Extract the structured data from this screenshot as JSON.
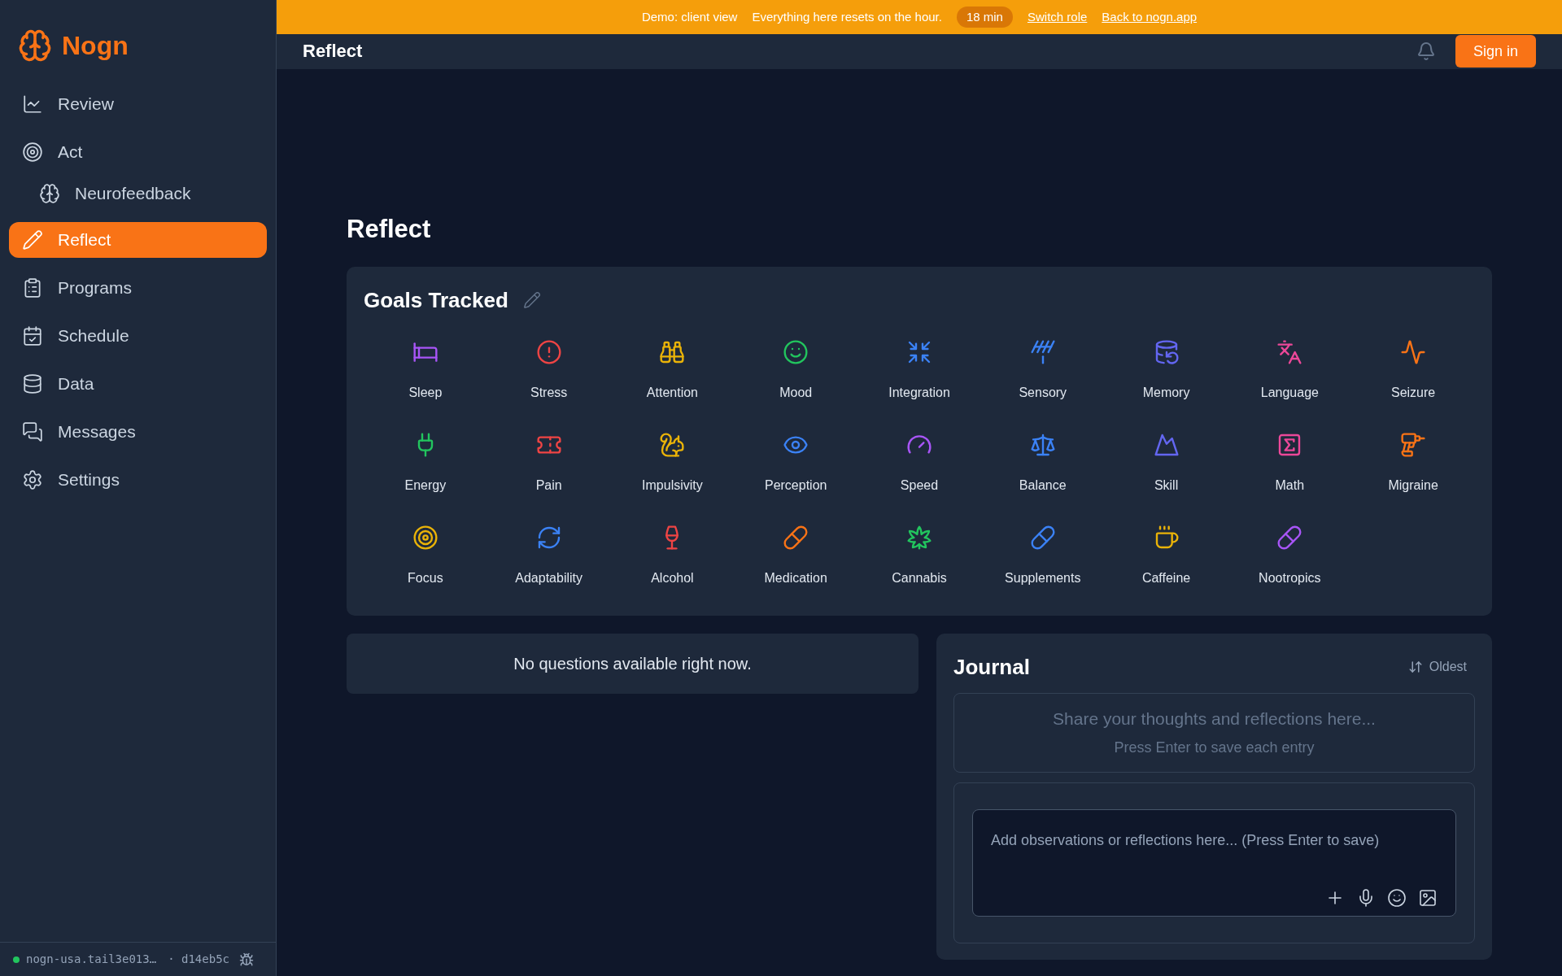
{
  "banner": {
    "mode": "Demo: client view",
    "note": "Everything here resets on the hour.",
    "timer": "18 min",
    "links": [
      "Switch role",
      "Back to nogn.app"
    ]
  },
  "header": {
    "title": "Reflect",
    "sign_in": "Sign in"
  },
  "sidebar": {
    "logo": "Nogn",
    "items": [
      {
        "label": "Review",
        "selected": false
      },
      {
        "label": "Act",
        "selected": false,
        "children": [
          {
            "label": "Neurofeedback",
            "selected": false
          }
        ]
      },
      {
        "label": "Reflect",
        "selected": true
      },
      {
        "label": "Programs",
        "selected": false
      },
      {
        "label": "Schedule",
        "selected": false
      },
      {
        "label": "Data",
        "selected": false
      },
      {
        "label": "Messages",
        "selected": false
      },
      {
        "label": "Settings",
        "selected": false
      }
    ],
    "status": {
      "host": "nogn-usa.tail3e013…",
      "commit": "· d14eb5c",
      "online": true
    }
  },
  "page_title": "Reflect",
  "goals": {
    "title": "Goals Tracked",
    "items": [
      {
        "label": "Sleep",
        "color": "#a855f7"
      },
      {
        "label": "Stress",
        "color": "#ef4444"
      },
      {
        "label": "Attention",
        "color": "#eab308"
      },
      {
        "label": "Mood",
        "color": "#22c55e"
      },
      {
        "label": "Integration",
        "color": "#3b82f6"
      },
      {
        "label": "Sensory",
        "color": "#3b82f6"
      },
      {
        "label": "Memory",
        "color": "#6366f1"
      },
      {
        "label": "Language",
        "color": "#ec4899"
      },
      {
        "label": "Seizure",
        "color": "#f97316"
      },
      {
        "label": "Energy",
        "color": "#22c55e"
      },
      {
        "label": "Pain",
        "color": "#ef4444"
      },
      {
        "label": "Impulsivity",
        "color": "#eab308"
      },
      {
        "label": "Perception",
        "color": "#3b82f6"
      },
      {
        "label": "Speed",
        "color": "#a855f7"
      },
      {
        "label": "Balance",
        "color": "#3b82f6"
      },
      {
        "label": "Skill",
        "color": "#6366f1"
      },
      {
        "label": "Math",
        "color": "#ec4899"
      },
      {
        "label": "Migraine",
        "color": "#f97316"
      },
      {
        "label": "Focus",
        "color": "#eab308"
      },
      {
        "label": "Adaptability",
        "color": "#3b82f6"
      },
      {
        "label": "Alcohol",
        "color": "#ef4444"
      },
      {
        "label": "Medication",
        "color": "#f97316"
      },
      {
        "label": "Cannabis",
        "color": "#22c55e"
      },
      {
        "label": "Supplements",
        "color": "#3b82f6"
      },
      {
        "label": "Caffeine",
        "color": "#eab308"
      },
      {
        "label": "Nootropics",
        "color": "#a855f7"
      }
    ]
  },
  "questions": {
    "message": "No questions available right now."
  },
  "journal": {
    "title": "Journal",
    "sort": "Oldest",
    "empty_title": "Share your thoughts and reflections here...",
    "empty_hint": "Press Enter to save each entry",
    "input": {
      "placeholder": "Add observations or reflections here... (Press Enter to save)"
    }
  }
}
